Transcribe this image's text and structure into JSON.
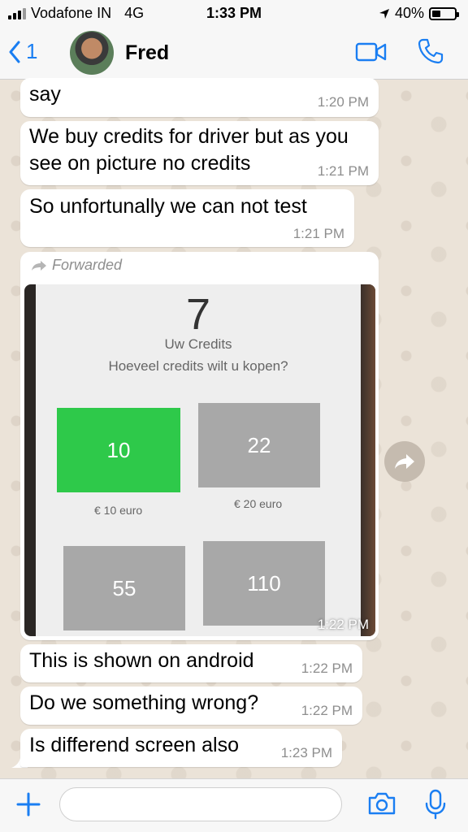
{
  "status_bar": {
    "carrier": "Vodafone IN",
    "network": "4G",
    "time": "1:33 PM",
    "battery_percent": "40%",
    "battery_level": 0.4
  },
  "header": {
    "back_count": "1",
    "contact_name": "Fred"
  },
  "messages": [
    {
      "text": "say",
      "time": "1:20 PM"
    },
    {
      "text_line1": "We buy credits for driver but as you",
      "text_line2": "see on picture no credits",
      "time": "1:21 PM"
    },
    {
      "text": "So unfortunally we can not test",
      "time": "1:21 PM"
    },
    {
      "forwarded_label": "Forwarded",
      "time": "1:22 PM",
      "photo": {
        "credit_count": "7",
        "credits_label": "Uw Credits",
        "question": "Hoeveel credits wilt u kopen?",
        "options": [
          {
            "amount": "10",
            "price": "€ 10 euro"
          },
          {
            "amount": "22",
            "price": "€ 20 euro"
          },
          {
            "amount": "55"
          },
          {
            "amount": "110"
          }
        ]
      }
    },
    {
      "text": "This is shown on android",
      "time": "1:22 PM"
    },
    {
      "text": "Do we something wrong?",
      "time": "1:22 PM"
    },
    {
      "text": "Is differend screen also",
      "time": "1:23 PM"
    }
  ],
  "icons": {
    "back": "chevron-left-icon",
    "video": "video-camera-icon",
    "call": "phone-icon",
    "forward": "forward-arrow-icon",
    "share": "share-icon",
    "add": "plus-icon",
    "camera": "camera-icon",
    "mic": "microphone-icon"
  },
  "colors": {
    "accent": "#1a7ef2",
    "selected_tile": "#2ec94a",
    "bubble": "#ffffff",
    "timestamp": "#8e8e8e"
  },
  "input": {
    "placeholder": "",
    "value": ""
  }
}
